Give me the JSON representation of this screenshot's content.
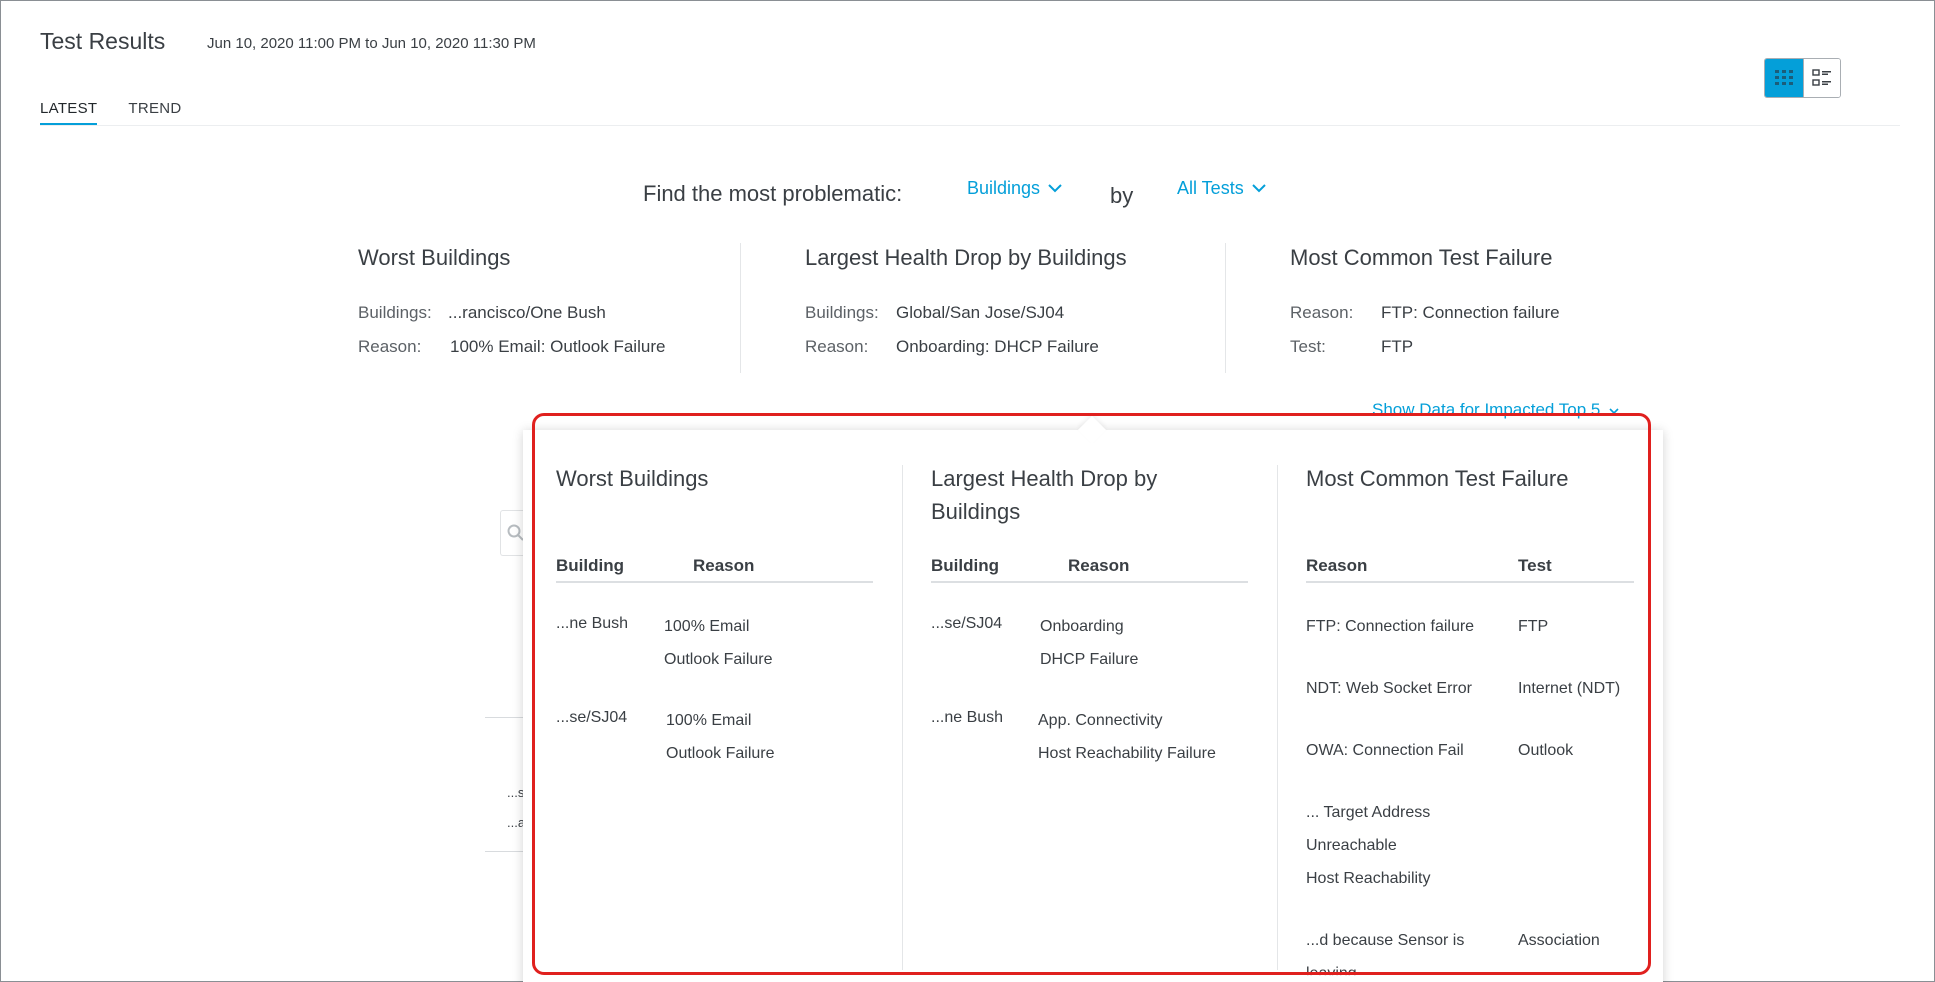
{
  "header": {
    "title": "Test Results",
    "date_range": "Jun 10, 2020 11:00 PM to Jun 10, 2020 11:30 PM"
  },
  "tabs": [
    {
      "label": "LATEST",
      "active": true
    },
    {
      "label": "TREND",
      "active": false
    }
  ],
  "view_toggle": {
    "options": [
      {
        "icon": "grid-view-icon",
        "active": true
      },
      {
        "icon": "list-view-icon",
        "active": false
      }
    ]
  },
  "finder": {
    "prompt": "Find the most problematic:",
    "group_by": "Buildings",
    "by_label": "by",
    "test_filter": "All Tests"
  },
  "summary": {
    "worst": {
      "title": "Worst Buildings",
      "rows": [
        {
          "key": "Buildings:",
          "value": "...rancisco/One Bush"
        },
        {
          "key": "Reason:",
          "value": "100% Email: Outlook Failure"
        }
      ]
    },
    "drop": {
      "title": "Largest Health Drop by Buildings",
      "rows": [
        {
          "key": "Buildings:",
          "value": "Global/San Jose/SJ04"
        },
        {
          "key": "Reason:",
          "value": "Onboarding: DHCP Failure"
        }
      ]
    },
    "common": {
      "title": "Most Common Test Failure",
      "rows": [
        {
          "key": "Reason:",
          "value": "FTP: Connection failure"
        },
        {
          "key": "Test:",
          "value": "FTP"
        }
      ]
    }
  },
  "impacted_link": "Show Data for Impacted Top 5",
  "ghost": {
    "row1": "...s",
    "row2": "...a"
  },
  "popover": {
    "worst": {
      "title": "Worst Buildings",
      "headers": [
        "Building",
        "Reason"
      ],
      "rows": [
        {
          "building": "...ne Bush",
          "reason_line1": "100% Email",
          "reason_line2": "Outlook Failure"
        },
        {
          "building": "...se/SJ04",
          "reason_line1": "100% Email",
          "reason_line2": "Outlook Failure"
        }
      ]
    },
    "drop": {
      "title": "Largest Health Drop by Buildings",
      "headers": [
        "Building",
        "Reason"
      ],
      "rows": [
        {
          "building": "...se/SJ04",
          "reason_line1": "Onboarding",
          "reason_line2": "DHCP Failure"
        },
        {
          "building": "...ne Bush",
          "reason_line1": "App. Connectivity",
          "reason_line2": "Host Reachability Failure"
        }
      ]
    },
    "common": {
      "title": "Most Common Test Failure",
      "headers": [
        "Reason",
        "Test"
      ],
      "rows": [
        {
          "reason": "FTP: Connection failure",
          "test": "FTP"
        },
        {
          "reason": "NDT: Web Socket Error",
          "test": "Internet (NDT)"
        },
        {
          "reason": "OWA: Connection Fail",
          "test": "Outlook"
        },
        {
          "reason_line1": "... Target Address",
          "reason_line2": "Unreachable",
          "reason_line3": "Host Reachability",
          "test": ""
        },
        {
          "reason_line1": "...d because Sensor is",
          "reason_line2": "leaving",
          "test": "Association"
        }
      ]
    }
  },
  "colors": {
    "accent": "#049fd9",
    "highlight": "#e0201e",
    "text": "#3a3f44"
  }
}
